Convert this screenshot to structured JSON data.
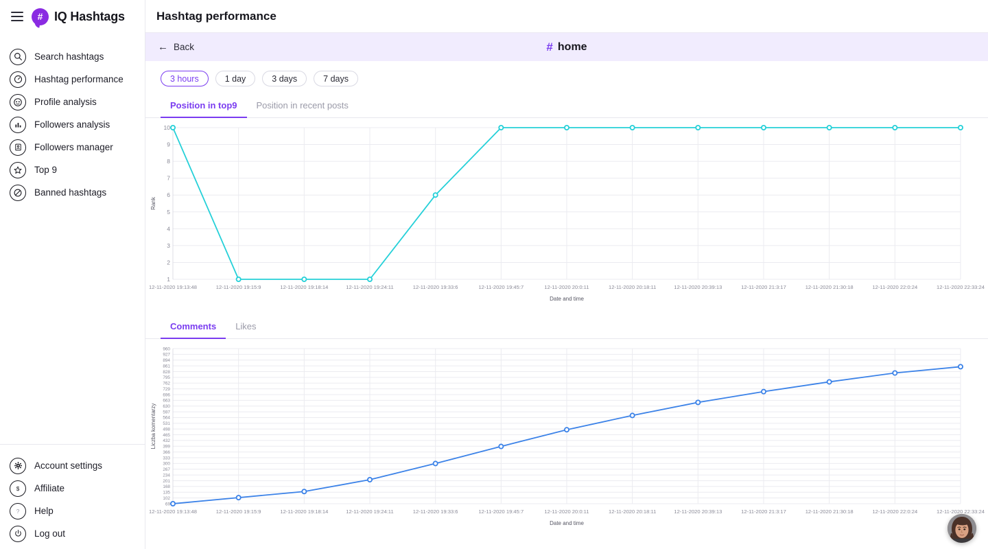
{
  "brand": {
    "name_prefix": "IQ",
    "name_main": "Hashtags",
    "logo_glyph": "#",
    "menu_icon": "hamburger-icon"
  },
  "sidebar": {
    "items": [
      {
        "label": "Search hashtags",
        "icon": "search-icon"
      },
      {
        "label": "Hashtag performance",
        "icon": "speedometer-icon"
      },
      {
        "label": "Profile analysis",
        "icon": "face-icon"
      },
      {
        "label": "Followers analysis",
        "icon": "bar-chart-icon"
      },
      {
        "label": "Followers manager",
        "icon": "contact-card-icon"
      },
      {
        "label": "Top 9",
        "icon": "star-icon"
      },
      {
        "label": "Banned hashtags",
        "icon": "no-entry-icon"
      }
    ],
    "bottom_items": [
      {
        "label": "Account settings",
        "icon": "gear-icon"
      },
      {
        "label": "Affiliate",
        "icon": "dollar-icon"
      },
      {
        "label": "Help",
        "icon": "question-mark-icon"
      },
      {
        "label": "Log out",
        "icon": "power-icon"
      }
    ]
  },
  "header": {
    "title": "Hashtag performance"
  },
  "subbar": {
    "back_label": "Back",
    "back_icon": "arrow-left-icon",
    "hashtag_glyph": "#",
    "hashtag_name": "home"
  },
  "ranges": {
    "options": [
      "3 hours",
      "1 day",
      "3 days",
      "7 days"
    ],
    "selected": "3 hours"
  },
  "position_tabs": {
    "items": [
      "Position in top9",
      "Position in recent posts"
    ],
    "selected": "Position in top9"
  },
  "engagement_tabs": {
    "items": [
      "Comments",
      "Likes"
    ],
    "selected": "Comments"
  },
  "colors": {
    "accent": "#7a3cf0",
    "subbar_bg": "#f1ecfe",
    "rank_line": "#25d0d8",
    "comments_line": "#3b82e8",
    "grid": "#ebebf0",
    "tick_text": "#8a8a97"
  },
  "chat_widget": {
    "name": "chat-support-avatar"
  },
  "chart_data": [
    {
      "id": "rank-chart",
      "type": "line",
      "title": "",
      "xlabel": "Date and time",
      "ylabel": "Rank",
      "ylim": [
        1,
        10
      ],
      "yticks": [
        1,
        2,
        3,
        4,
        5,
        6,
        7,
        8,
        9,
        10
      ],
      "grid": true,
      "line_color": "#25d0d8",
      "categories": [
        "12-11-2020 19:13:48",
        "12-11-2020 19:15:9",
        "12-11-2020 19:18:14",
        "12-11-2020 19:24:11",
        "12-11-2020 19:33:6",
        "12-11-2020 19:45:7",
        "12-11-2020 20:0:11",
        "12-11-2020 20:18:11",
        "12-11-2020 20:39:13",
        "12-11-2020 21:3:17",
        "12-11-2020 21:30:18",
        "12-11-2020 22:0:24",
        "12-11-2020 22:33:24"
      ],
      "values": [
        10,
        1,
        1,
        1,
        6,
        10,
        10,
        10,
        10,
        10,
        10,
        10,
        10
      ]
    },
    {
      "id": "comments-chart",
      "type": "line",
      "title": "",
      "xlabel": "Date and time",
      "ylabel": "Liczba komentarzy",
      "ylim": [
        69,
        960
      ],
      "yticks": [
        69,
        102,
        135,
        168,
        201,
        234,
        267,
        300,
        333,
        366,
        399,
        432,
        465,
        498,
        531,
        564,
        597,
        630,
        663,
        696,
        729,
        762,
        795,
        828,
        861,
        894,
        927,
        960
      ],
      "grid": true,
      "line_color": "#3b82e8",
      "categories": [
        "12-11-2020 19:13:48",
        "12-11-2020 19:15:9",
        "12-11-2020 19:18:14",
        "12-11-2020 19:24:11",
        "12-11-2020 19:33:6",
        "12-11-2020 19:45:7",
        "12-11-2020 20:0:11",
        "12-11-2020 20:18:11",
        "12-11-2020 20:39:13",
        "12-11-2020 21:3:17",
        "12-11-2020 21:30:18",
        "12-11-2020 22:0:24",
        "12-11-2020 22:33:24"
      ],
      "values": [
        69,
        104,
        139,
        207,
        300,
        398,
        494,
        576,
        651,
        713,
        769,
        820,
        856
      ]
    }
  ]
}
